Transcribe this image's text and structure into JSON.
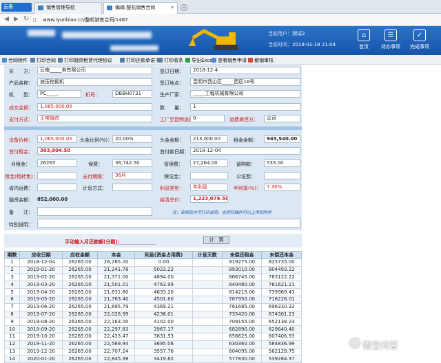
{
  "tabs": {
    "brand": "云表",
    "t1": "销售管理导航",
    "t2": "编辑:整机销售合同"
  },
  "address": {
    "url": "www.iyunbiao.cn/整机销售合同/1487"
  },
  "header": {
    "user_label": "当前用户：",
    "user": "测试2",
    "time_label": "当前时间：",
    "time": "2019-01-18 21:04",
    "home": "首页",
    "todo": "待办事项",
    "done": "完成事项"
  },
  "toolbar": [
    "合同附件",
    "打印合同",
    "打印融资租赁代理协议",
    "打印还款承诺书",
    "打印收条",
    "导出Excel",
    "查看销售申请",
    "撤销审核"
  ],
  "form": {
    "buyer_label": "买　　方：",
    "buyer": "云南_____务有限公司",
    "sign_date_label": "签订日期：",
    "sign_date": "2018-12-4",
    "product_label": "产品名称：",
    "product": "液压挖掘机",
    "sign_place_label": "签订地点：",
    "sign_place": "昆明市西山区_____西区16号",
    "model_label": "机　　型：",
    "model": "PC_____",
    "machine_no_label": "机号：",
    "machine_no": "DBBH0731",
    "maker_label": "生产厂家：",
    "maker": "_____工程机械有限公司",
    "amount_label": "成交金额：",
    "amount": "1,065,000.00",
    "qty_label": "数　　量：",
    "qty": "1",
    "pay_label": "支付方式：",
    "pay": "正常融资",
    "freight_label": "工厂至昆明运费：",
    "freight": "0",
    "freight_bear_label": "运费承担方：",
    "freight_bear": "公司",
    "price_label": "设备价格：",
    "price": "1,065,000.00",
    "dp_ratio_label": "头金比例(%)：",
    "dp_ratio": "20.00%",
    "dp_label": "头金金额：",
    "dp": "213,000.00",
    "rent_total_label": "租金金额：",
    "rent_total": "945,540.00",
    "first_rent_label": "首付租金：",
    "first_rent": "303,804.50",
    "first_date_label": "首付款日期：",
    "first_date": "2018-12-04",
    "monthly_label": "月租金：",
    "monthly": "26265",
    "deposit_label": "保费：",
    "deposit": "36,742.50",
    "mgmt_label": "管理费：",
    "mgmt": "27,264.00",
    "left_label": "留购款：",
    "left": "533.00",
    "prepay_label": "租金(租转售)：",
    "prepay": "",
    "period_label": "支付期限：",
    "period": "36月",
    "guarantee_label": "保证金：",
    "guarantee": "",
    "notary_label": "公证费：",
    "notary": "",
    "local_freight_label": "省内运费：",
    "local_freight": "",
    "calc_label": "计息方式：",
    "calc": "",
    "rate_type_label": "利息类型：",
    "rate_type": "年利息",
    "rate_label": "年利率(%)：",
    "rate": "7.30%",
    "loan_total_label": "融资金额：",
    "loan_total": "852,000.00",
    "total_label": "结清总价：",
    "total": "1,223,079.50",
    "remark_label": "备　　注：",
    "remark": "",
    "note": "注：审核后方可打印合同，合同扫描件可以上传到附件",
    "special_label": "特别说明：",
    "special": ""
  },
  "repay": {
    "label": "手动输入月还款额(分期):",
    "button": "计　算"
  },
  "table": {
    "headers": [
      "期数",
      "应收日期",
      "应收金额",
      "本金",
      "利息(资金占用费)",
      "计息天数",
      "未偿还租金",
      "未偿还本金"
    ],
    "rows": [
      [
        "1",
        "2018-12-04",
        "26265.00",
        "26,265.00",
        "0.00",
        "",
        "919275.00",
        "825735.00"
      ],
      [
        "2",
        "2019-01-20",
        "26265.00",
        "21,241.78",
        "5023.22",
        "",
        "893010.00",
        "804493.22"
      ],
      [
        "3",
        "2019-02-20",
        "26265.00",
        "21,371.00",
        "4894.00",
        "",
        "866745.00",
        "783122.22"
      ],
      [
        "4",
        "2019-03-20",
        "26265.00",
        "21,501.01",
        "4763.99",
        "",
        "840480.00",
        "761621.21"
      ],
      [
        "5",
        "2019-04-20",
        "26265.00",
        "21,631.80",
        "4633.20",
        "",
        "814215.00",
        "739989.41"
      ],
      [
        "6",
        "2019-05-20",
        "26265.00",
        "21,763.40",
        "4501.60",
        "",
        "787950.00",
        "718226.01"
      ],
      [
        "7",
        "2019-06-20",
        "26265.00",
        "21,895.79",
        "4369.21",
        "",
        "761685.00",
        "696330.22"
      ],
      [
        "8",
        "2019-07-20",
        "26265.00",
        "22,028.99",
        "4236.01",
        "",
        "735420.00",
        "674301.23"
      ],
      [
        "9",
        "2019-08-20",
        "26265.00",
        "22,163.00",
        "4102.00",
        "",
        "709155.00",
        "652138.23"
      ],
      [
        "10",
        "2019-09-20",
        "26265.00",
        "22,297.83",
        "3967.17",
        "",
        "682890.00",
        "629840.40"
      ],
      [
        "11",
        "2019-10-20",
        "26265.00",
        "22,433.47",
        "3831.53",
        "",
        "656625.00",
        "607406.93"
      ],
      [
        "12",
        "2019-11-20",
        "26265.00",
        "22,569.94",
        "3695.06",
        "",
        "630360.00",
        "584836.99"
      ],
      [
        "13",
        "2019-12-20",
        "26265.00",
        "22,707.24",
        "3557.76",
        "",
        "604095.00",
        "562129.75"
      ],
      [
        "14",
        "2020-01-20",
        "26265.00",
        "22,845.38",
        "3419.62",
        "",
        "577830.00",
        "539284.37"
      ]
    ]
  },
  "watermark": "悟空问答"
}
